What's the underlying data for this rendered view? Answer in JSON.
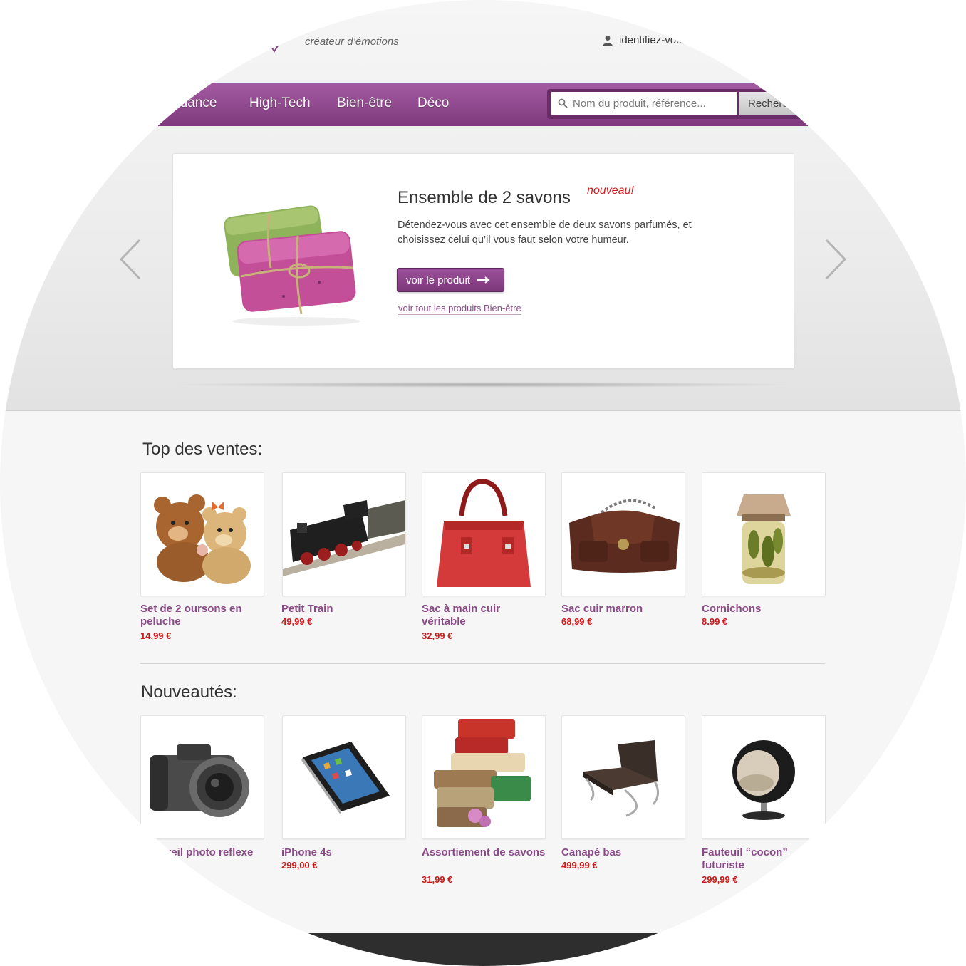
{
  "header": {
    "tagline": "créateur d’émotions",
    "login_label": "identifiez-vous"
  },
  "nav": {
    "items": [
      "Tendance",
      "High-Tech",
      "Bien-être",
      "Déco"
    ],
    "search_placeholder": "Nom du produit, référence...",
    "search_button": "Rechercher"
  },
  "slide": {
    "title": "Ensemble de 2 savons",
    "badge": "nouveau!",
    "description": "Détendez-vous avec cet ensemble de deux savons parfumés, et choisissez celui qu’il vous faut selon votre humeur.",
    "cta_label": "voir le produit",
    "link_label": "voir tout les produits Bien-être"
  },
  "top_sales": {
    "title": "Top des ventes:",
    "products": [
      {
        "name": "Set de 2 oursons en peluche",
        "price": "14,99 €",
        "icon": "teddy-bears"
      },
      {
        "name": "Petit Train",
        "price": "49,99 €",
        "icon": "toy-train"
      },
      {
        "name": "Sac à main cuir véritable",
        "price": "32,99 €",
        "icon": "red-handbag"
      },
      {
        "name": "Sac cuir marron",
        "price": "68,99 €",
        "icon": "brown-bag"
      },
      {
        "name": "Cornichons",
        "price": "8.99 €",
        "icon": "pickle-jar"
      }
    ]
  },
  "new_items": {
    "title": "Nouveautés:",
    "products": [
      {
        "name": "Appareil photo reflexe",
        "price": "",
        "icon": "camera"
      },
      {
        "name": "iPhone 4s",
        "price": "299,00 €",
        "icon": "smartphone"
      },
      {
        "name": "Assortiement de savons",
        "price": "31,99 €",
        "icon": "soap-stack"
      },
      {
        "name": "Canapé bas",
        "price": "499,99 €",
        "icon": "lounge-chair"
      },
      {
        "name": "Fauteuil “cocon” futuriste",
        "price": "299,99 €",
        "icon": "egg-chair"
      }
    ]
  },
  "colors": {
    "brand_purple": "#8a4a88",
    "price_red": "#cc1a1a"
  }
}
